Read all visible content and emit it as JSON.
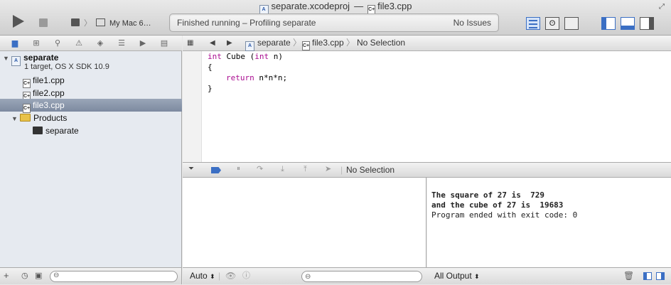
{
  "window": {
    "project": "separate.xcodeproj",
    "separator": "—",
    "file": "file3.cpp"
  },
  "toolbar": {
    "scheme_device": "My Mac 6…",
    "status_text": "Finished running – Profiling separate",
    "issues": "No Issues"
  },
  "navigator": {
    "project_name": "separate",
    "project_subtitle": "1 target, OS X SDK 10.9",
    "files": [
      "file1.cpp",
      "file2.cpp",
      "file3.cpp"
    ],
    "group": "Products",
    "product": "separate"
  },
  "jumpbar": {
    "project": "separate",
    "file": "file3.cpp",
    "selection": "No Selection"
  },
  "code": {
    "l1_type": "int",
    "l1_name": " Cube (",
    "l1_ptype": "int",
    "l1_rest": " n)",
    "l2": "{",
    "l3_kw": "return",
    "l3_rest": " n*n*n;",
    "l4": "}"
  },
  "debug": {
    "selection": "No Selection",
    "auto_label": "Auto",
    "output_label": "All Output"
  },
  "console": {
    "lines": [
      "The square of 27 is  729",
      "and the cube of 27 is  19683",
      "Program ended with exit code: 0"
    ]
  },
  "colors": {
    "accent": "#3b6fc4",
    "keyword": "#aa0d91",
    "selection": "#8793a8"
  }
}
